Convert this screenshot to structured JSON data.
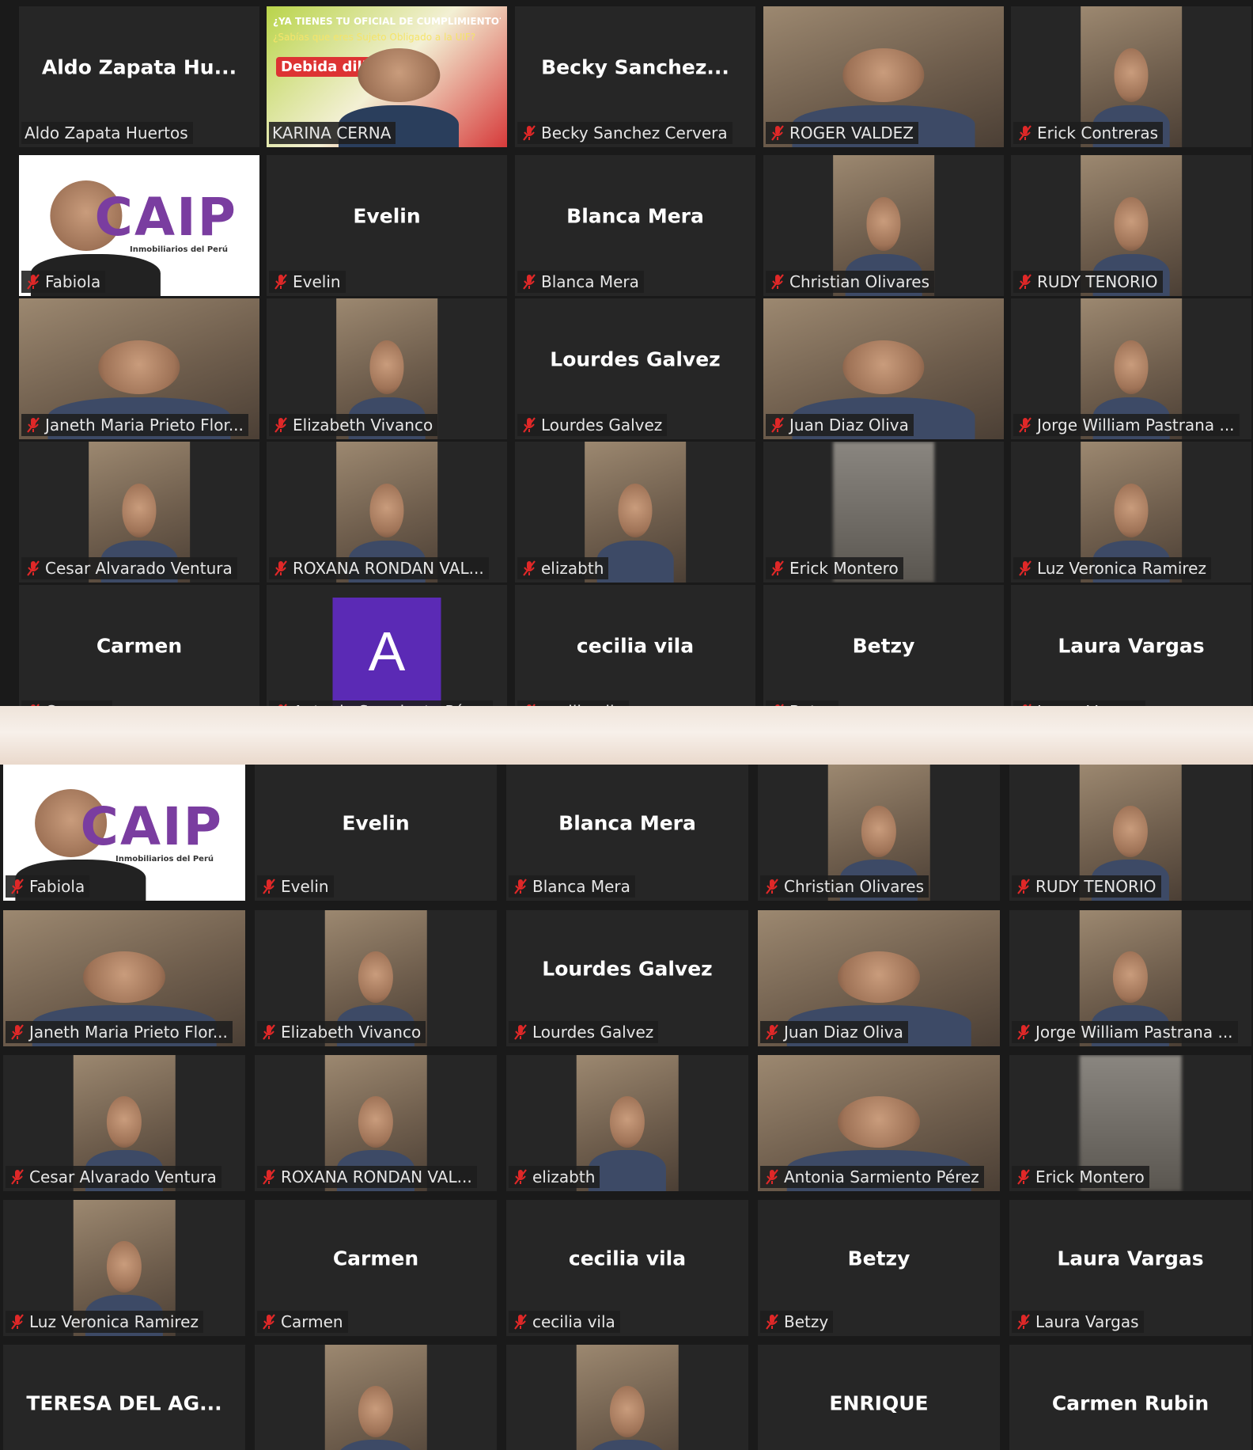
{
  "meeting_view": "gallery",
  "accent_colors": {
    "active_speaker_border": "#d7ec4a",
    "mute_icon": "#e02828",
    "tile_bg": "#262626",
    "avatar_bg": "#5b2ab5"
  },
  "poster": {
    "line1": "¿YA TIENES TU OFICIAL DE CUMPLIMIENTO?",
    "line2": "¿Sabías que eres Sujeto Obligado a la UIF?",
    "line3": "Debida diligencia",
    "logo_text": "CAIP",
    "logo_sub": "Inmobiliarios del Perú"
  },
  "top_screen": {
    "participants": [
      {
        "display": "Aldo Zapata Hu...",
        "label": "Aldo Zapata Huertos",
        "video": false,
        "muted": false
      },
      {
        "display": "",
        "label": "KARINA CERNA",
        "video": "poster",
        "muted": false,
        "speaking": true
      },
      {
        "display": "Becky  Sanchez...",
        "label": "Becky Sanchez Cervera",
        "video": false,
        "muted": true
      },
      {
        "display": "",
        "label": "ROGER VALDEZ",
        "video": "full",
        "muted": true
      },
      {
        "display": "",
        "label": "Erick Contreras",
        "video": "narrow",
        "muted": true
      },
      {
        "display": "",
        "label": "Fabiola",
        "video": "logo",
        "muted": true
      },
      {
        "display": "Evelin",
        "label": "Evelin",
        "video": false,
        "muted": true
      },
      {
        "display": "Blanca Mera",
        "label": "Blanca Mera",
        "video": false,
        "muted": true
      },
      {
        "display": "",
        "label": "Christian Olivares",
        "video": "narrow",
        "muted": true
      },
      {
        "display": "",
        "label": "RUDY TENORIO",
        "video": "narrow",
        "muted": true
      },
      {
        "display": "",
        "label": "Janeth Maria Prieto Flor...",
        "video": "full",
        "muted": true
      },
      {
        "display": "",
        "label": "Elizabeth Vivanco",
        "video": "narrow",
        "muted": true
      },
      {
        "display": "Lourdes Galvez",
        "label": "Lourdes Galvez",
        "video": false,
        "muted": true
      },
      {
        "display": "",
        "label": "Juan Diaz Oliva",
        "video": "full",
        "muted": true
      },
      {
        "display": "",
        "label": "Jorge William Pastrana ...",
        "video": "narrow",
        "muted": true
      },
      {
        "display": "",
        "label": "Cesar Alvarado Ventura",
        "video": "narrow",
        "muted": true
      },
      {
        "display": "",
        "label": "ROXANA RONDAN VAL...",
        "video": "narrow",
        "muted": true
      },
      {
        "display": "",
        "label": "elizabth",
        "video": "narrow",
        "muted": true
      },
      {
        "display": "",
        "label": "Erick Montero",
        "video": "blur",
        "muted": true
      },
      {
        "display": "",
        "label": "Luz Veronica Ramirez",
        "video": "narrow",
        "muted": true
      },
      {
        "display": "Carmen",
        "label": "Carmen",
        "video": false,
        "muted": true
      },
      {
        "display": "",
        "label": "Antonia Sarmiento Pérez",
        "video": "avatar",
        "avatar": "A",
        "muted": true
      },
      {
        "display": "cecilia vila",
        "label": "cecilia vila",
        "video": false,
        "muted": true
      },
      {
        "display": "Betzy",
        "label": "Betzy",
        "video": false,
        "muted": true
      },
      {
        "display": "Laura Vargas",
        "label": "Laura Vargas",
        "video": false,
        "muted": true
      }
    ]
  },
  "bottom_screen": {
    "participants": [
      {
        "display": "",
        "label": "Fabiola",
        "video": "logo",
        "muted": true
      },
      {
        "display": "Evelin",
        "label": "Evelin",
        "video": false,
        "muted": true
      },
      {
        "display": "Blanca Mera",
        "label": "Blanca Mera",
        "video": false,
        "muted": true
      },
      {
        "display": "",
        "label": "Christian Olivares",
        "video": "narrow",
        "muted": true
      },
      {
        "display": "",
        "label": "RUDY TENORIO",
        "video": "narrow",
        "muted": true
      },
      {
        "display": "",
        "label": "Janeth Maria Prieto Flor...",
        "video": "full",
        "muted": true
      },
      {
        "display": "",
        "label": "Elizabeth Vivanco",
        "video": "narrow",
        "muted": true
      },
      {
        "display": "Lourdes Galvez",
        "label": "Lourdes Galvez",
        "video": false,
        "muted": true
      },
      {
        "display": "",
        "label": "Juan Diaz Oliva",
        "video": "full",
        "muted": true
      },
      {
        "display": "",
        "label": "Jorge William Pastrana ...",
        "video": "narrow",
        "muted": true
      },
      {
        "display": "",
        "label": "Cesar Alvarado Ventura",
        "video": "narrow",
        "muted": true
      },
      {
        "display": "",
        "label": "ROXANA RONDAN VAL...",
        "video": "narrow",
        "muted": true
      },
      {
        "display": "",
        "label": "elizabth",
        "video": "narrow",
        "muted": true
      },
      {
        "display": "",
        "label": "Antonia Sarmiento Pérez",
        "video": "full",
        "muted": true
      },
      {
        "display": "",
        "label": "Erick Montero",
        "video": "blur",
        "muted": true
      },
      {
        "display": "",
        "label": "Luz Veronica Ramirez",
        "video": "narrow",
        "muted": true
      },
      {
        "display": "Carmen",
        "label": "Carmen",
        "video": false,
        "muted": true
      },
      {
        "display": "cecilia vila",
        "label": "cecilia vila",
        "video": false,
        "muted": true
      },
      {
        "display": "Betzy",
        "label": "Betzy",
        "video": false,
        "muted": true
      },
      {
        "display": "Laura Vargas",
        "label": "Laura Vargas",
        "video": false,
        "muted": true
      },
      {
        "display": "TERESA DEL AG...",
        "label": "",
        "video": false,
        "muted": false
      },
      {
        "display": "",
        "label": "",
        "video": "narrow",
        "muted": false
      },
      {
        "display": "",
        "label": "",
        "video": "narrow",
        "muted": false
      },
      {
        "display": "ENRIQUE",
        "label": "",
        "video": false,
        "muted": false
      },
      {
        "display": "Carmen Rubin",
        "label": "",
        "video": false,
        "muted": false
      }
    ]
  }
}
